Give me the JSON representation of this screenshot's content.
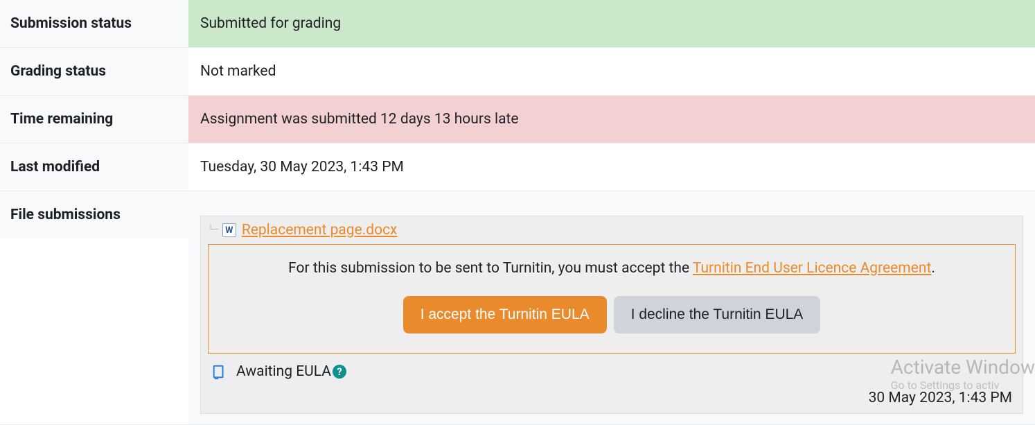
{
  "rows": {
    "submission_status": {
      "label": "Submission status",
      "value": "Submitted for grading"
    },
    "grading_status": {
      "label": "Grading status",
      "value": "Not marked"
    },
    "time_remaining": {
      "label": "Time remaining",
      "value": "Assignment was submitted 12 days 13 hours late"
    },
    "last_modified": {
      "label": "Last modified",
      "value": "Tuesday, 30 May 2023, 1:43 PM"
    },
    "file_submissions": {
      "label": "File submissions"
    }
  },
  "file": {
    "name": "Replacement page.docx"
  },
  "turnitin": {
    "prompt_prefix": "For this submission to be sent to Turnitin, you must accept the ",
    "eula_link_text": "Turnitin End User Licence Agreement",
    "prompt_suffix": ".",
    "accept_label": "I accept the Turnitin EULA",
    "decline_label": "I decline the Turnitin EULA",
    "status_text": "Awaiting EULA",
    "timestamp": "30 May 2023, 1:43 PM"
  },
  "watermark": {
    "title": "Activate Window",
    "sub": "Go to Settings to activ"
  }
}
